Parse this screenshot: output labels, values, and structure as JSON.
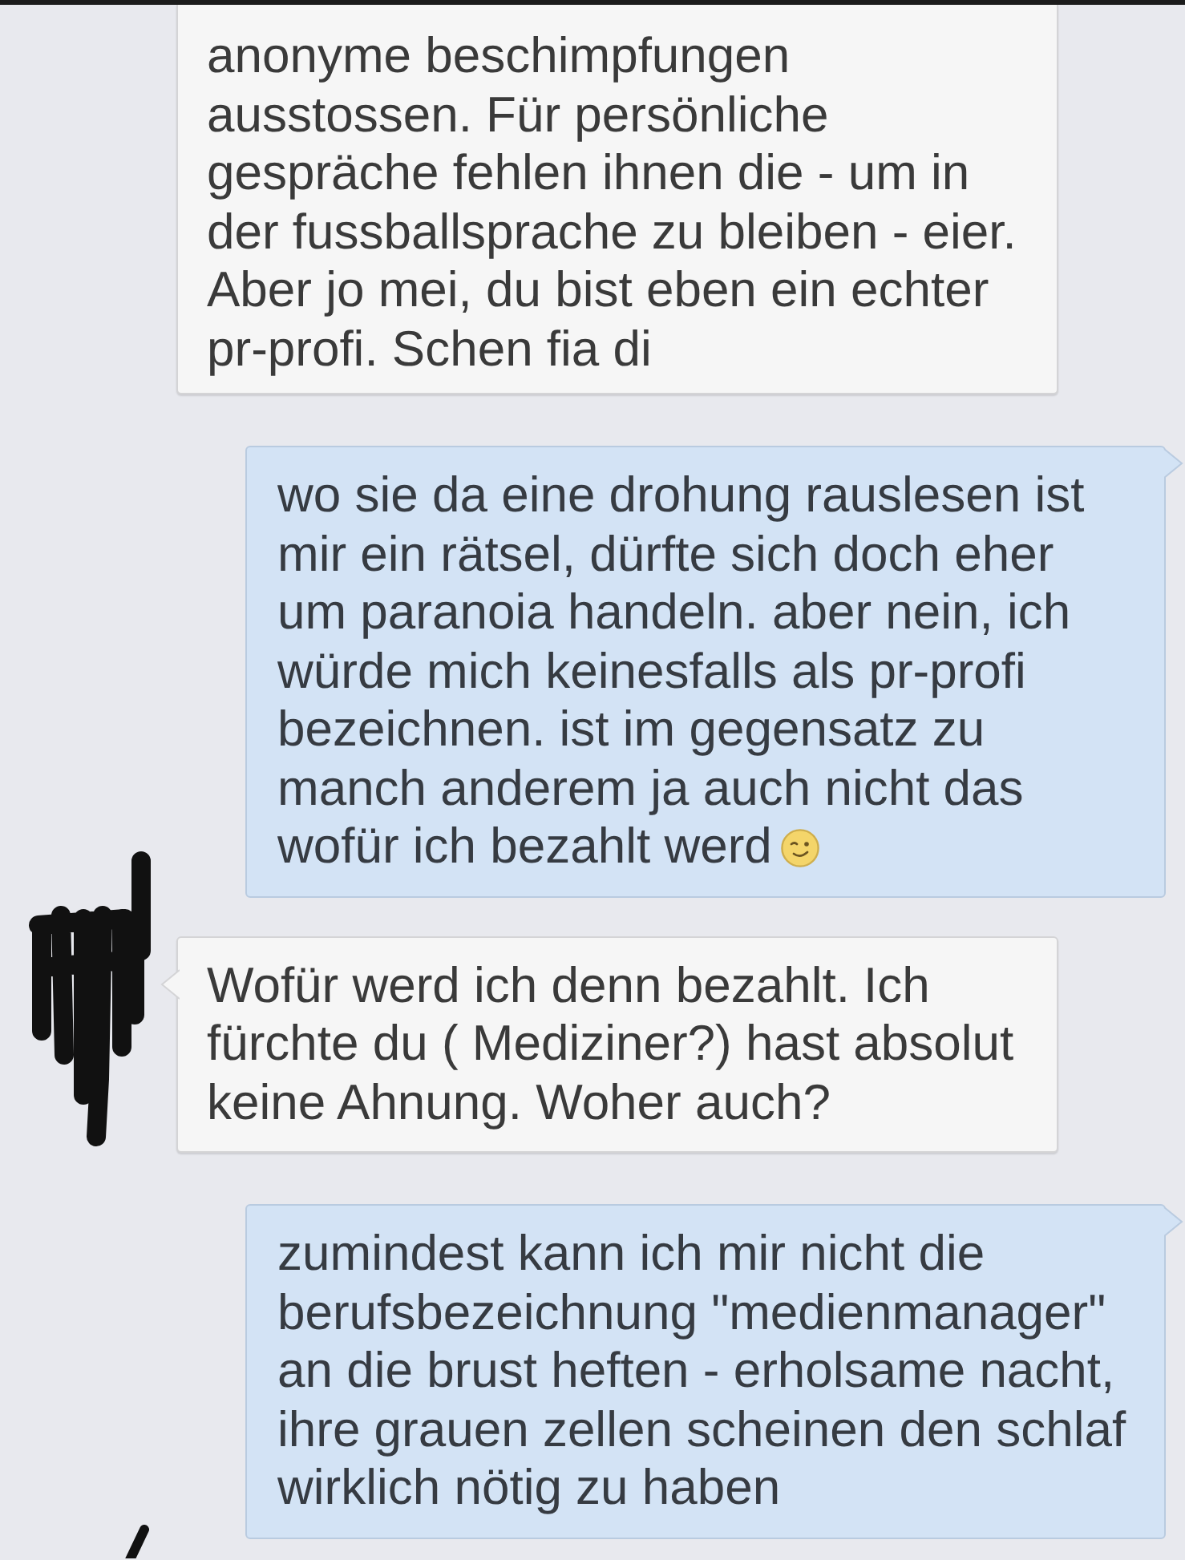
{
  "conversation": {
    "messages": [
      {
        "kind": "incoming",
        "cut_off": true,
        "avatar": false,
        "emoticon": false,
        "text": "anonyme beschimpfungen ausstossen. Für persönliche gespräche fehlen ihnen die - um in der fussballsprache zu bleiben - eier. Aber jo mei, du bist eben ein echter pr-profi. Schen fia di"
      },
      {
        "kind": "outgoing",
        "cut_off": false,
        "avatar": false,
        "emoticon": true,
        "text": "wo sie da eine drohung rauslesen ist mir ein rätsel, dürfte sich doch eher um paranoia handeln. aber nein, ich würde mich keinesfalls als pr-profi bezeichnen. ist im gegensatz zu manch anderem ja auch nicht das wofür ich bezahlt werd"
      },
      {
        "kind": "incoming",
        "cut_off": false,
        "avatar": true,
        "emoticon": false,
        "text": "Wofür werd ich denn bezahlt. Ich fürchte du ( Mediziner?) hast absolut keine Ahnung. Woher auch?"
      },
      {
        "kind": "outgoing",
        "cut_off": false,
        "avatar": false,
        "emoticon": false,
        "text": "zumindest kann ich mir nicht die berufsbezeichnung \"medienmanager\" an die brust heften - erholsame nacht, ihre grauen zellen scheinen den schlaf wirklich nötig zu haben"
      },
      {
        "kind": "incoming",
        "cut_off": true,
        "avatar": true
      }
    ]
  }
}
